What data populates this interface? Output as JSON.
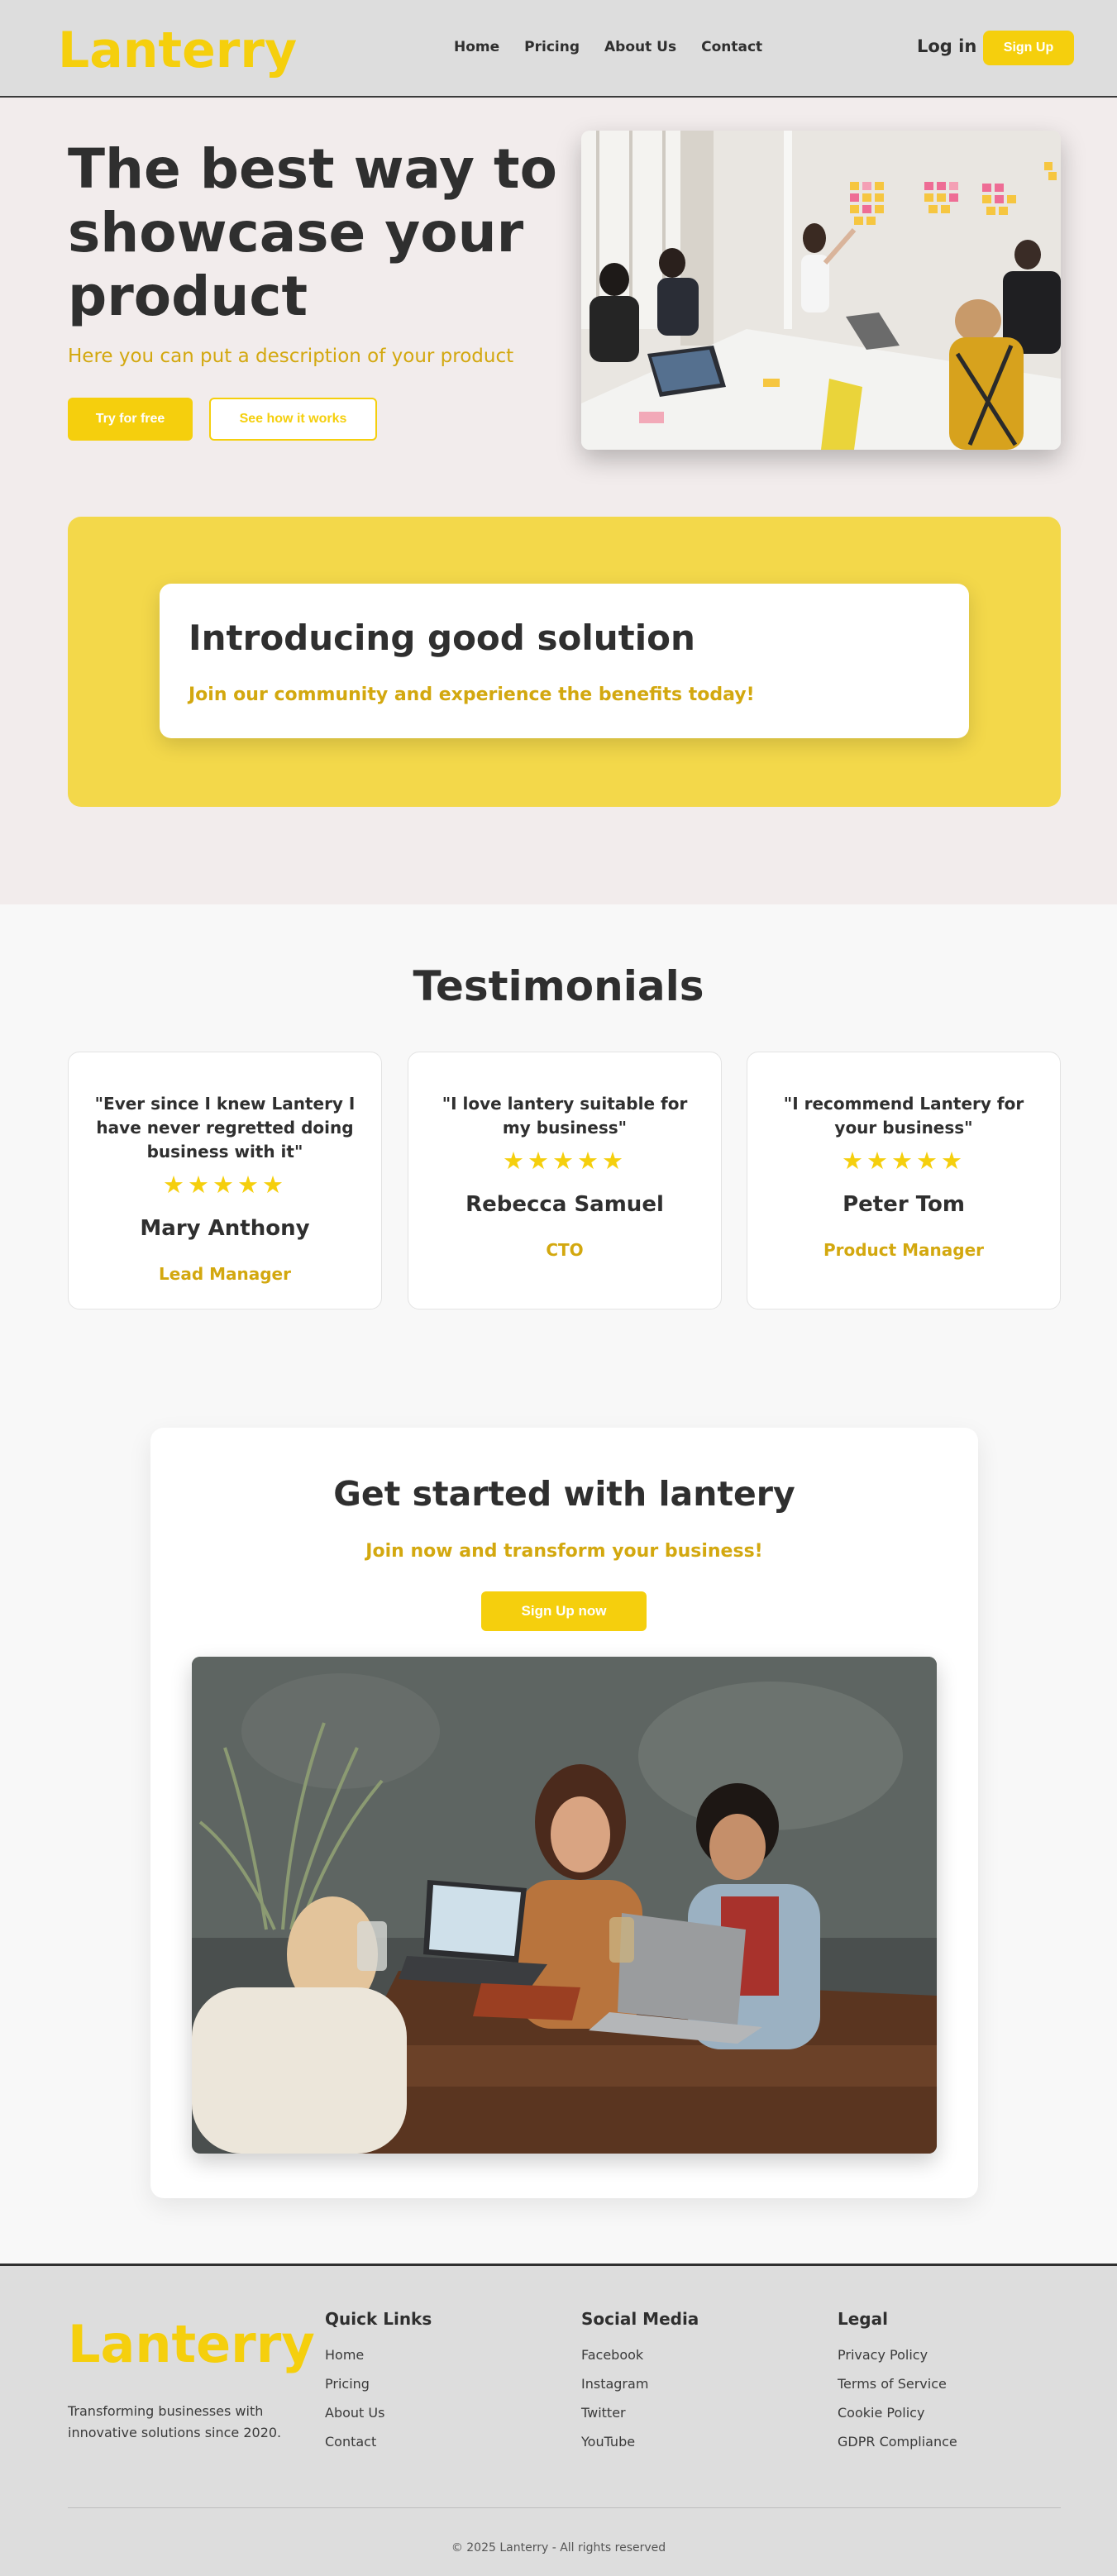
{
  "header": {
    "logo": "Lanterry",
    "nav": [
      "Home",
      "Pricing",
      "About Us",
      "Contact"
    ],
    "login": "Log in",
    "signup": "Sign Up"
  },
  "hero": {
    "title": "The best way to showcase your product",
    "description": "Here you can put a description of your product",
    "try_button": "Try for free",
    "see_button": "See how it works"
  },
  "intro": {
    "title": "Introducing good solution",
    "subtitle": "Join our community and experience the benefits today!"
  },
  "testimonials": {
    "title": "Testimonials",
    "items": [
      {
        "quote": "\"Ever since I knew Lantery I have never regretted doing business with it\"",
        "stars": "★★★★★",
        "rating": 5,
        "name": "Mary Anthony",
        "role": "Lead Manager"
      },
      {
        "quote": "\"I love lantery suitable for my business\"",
        "stars": "★★★★★",
        "rating": 5,
        "name": "Rebecca Samuel",
        "role": "CTO"
      },
      {
        "quote": "\"I recommend Lantery for your business\"",
        "stars": "★★★★★",
        "rating": 5,
        "name": "Peter Tom",
        "role": "Product Manager"
      }
    ]
  },
  "get_started": {
    "title": "Get started with lantery",
    "subtitle": "Join now and transform your business!",
    "button": "Sign Up now"
  },
  "footer": {
    "logo": "Lanterry",
    "tagline": "Transforming businesses with innovative solutions since 2020.",
    "quick_links": {
      "title": "Quick Links",
      "items": [
        "Home",
        "Pricing",
        "About Us",
        "Contact"
      ]
    },
    "social": {
      "title": "Social Media",
      "items": [
        "Facebook",
        "Instagram",
        "Twitter",
        "YouTube"
      ]
    },
    "legal": {
      "title": "Legal",
      "items": [
        "Privacy Policy",
        "Terms of Service",
        "Cookie Policy",
        "GDPR Compliance"
      ]
    },
    "copyright": "© 2025 Lanterry - All rights reserved"
  },
  "colors": {
    "brand_yellow": "#f5cf0d",
    "accent_gold": "#d3a80f",
    "block_yellow": "#f3d84a",
    "text_dark": "#2f2f2f",
    "header_gray": "#dddddd"
  }
}
